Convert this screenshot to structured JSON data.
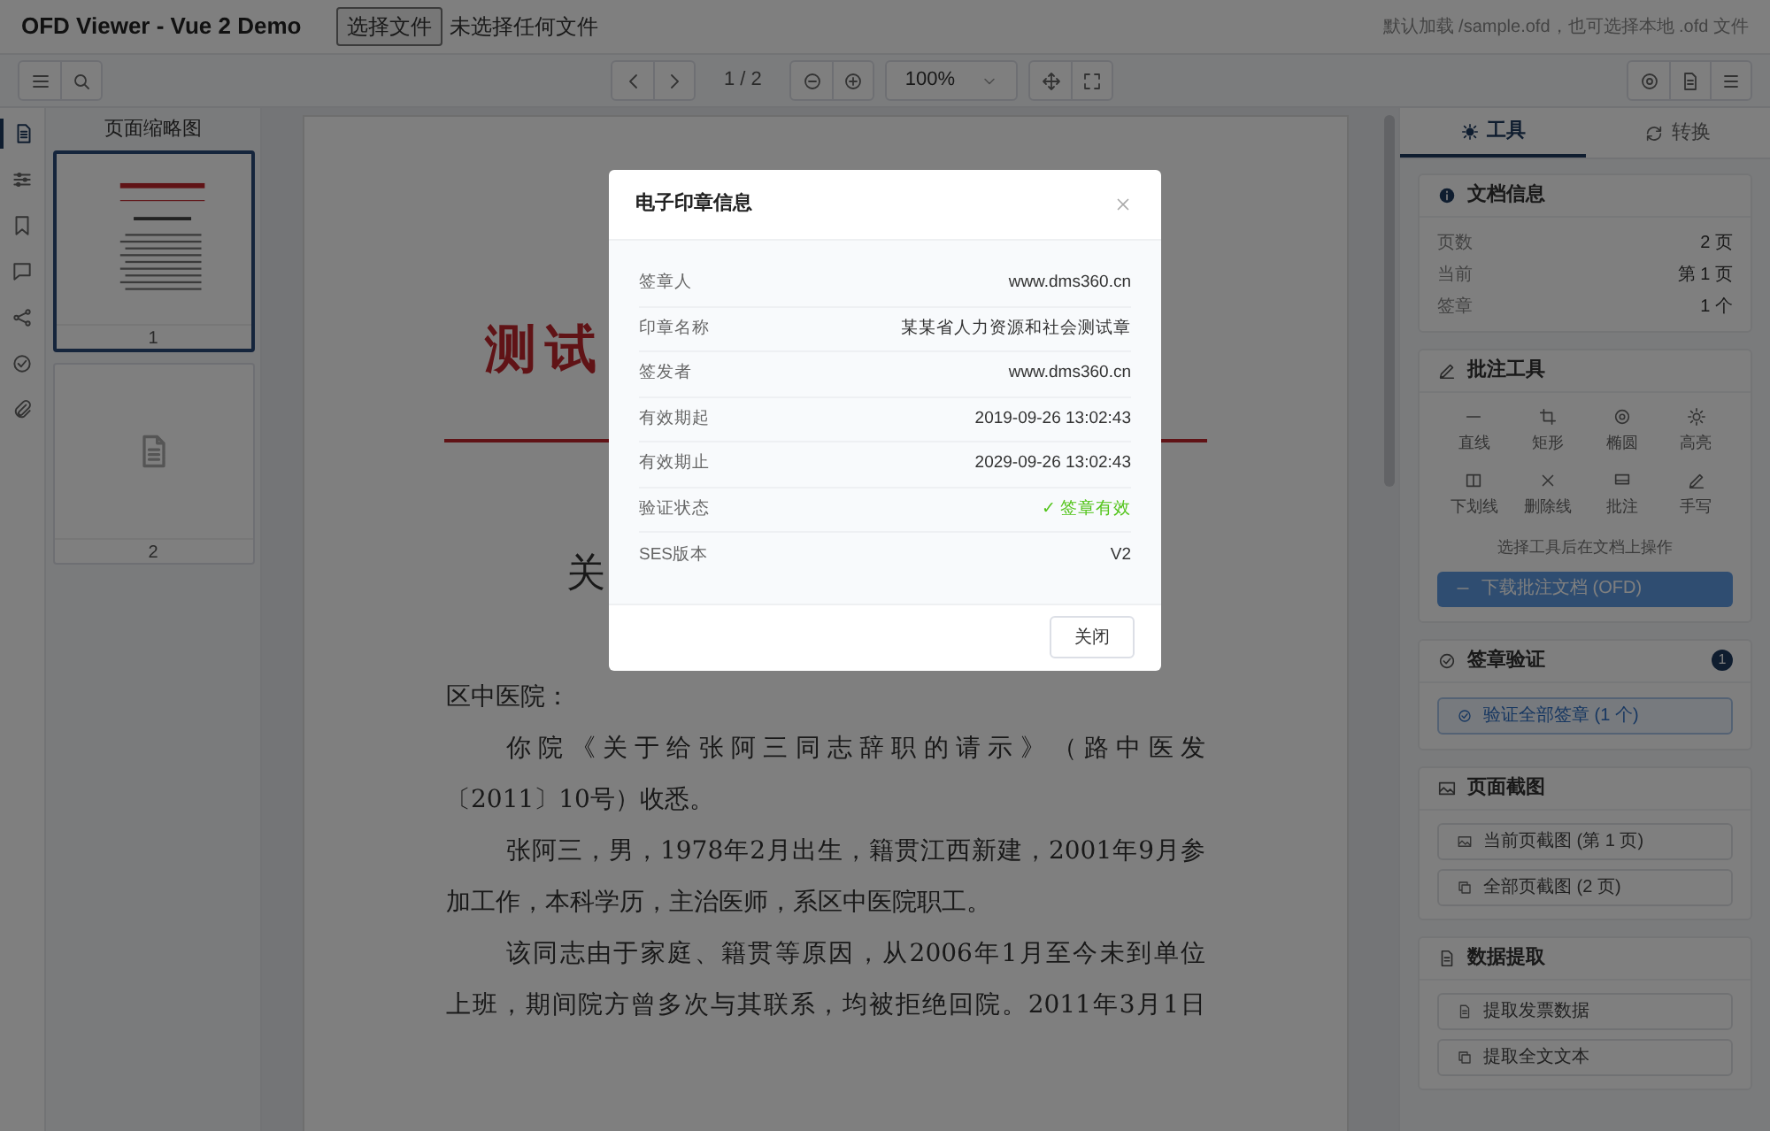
{
  "app": {
    "title": "OFD Viewer - Vue 2 Demo",
    "file_button": "选择文件",
    "file_status": "未选择任何文件",
    "hint": "默认加载 /sample.ofd，也可选择本地 .ofd 文件"
  },
  "toolbar": {
    "page_indicator": "1 / 2",
    "zoom": "100%"
  },
  "rail": [
    {
      "kind": "pages",
      "selected": true
    },
    {
      "kind": "outline",
      "selected": false
    },
    {
      "kind": "bookmark",
      "selected": false
    },
    {
      "kind": "annotations",
      "selected": false
    },
    {
      "kind": "share",
      "selected": false
    },
    {
      "kind": "seal",
      "selected": false
    },
    {
      "kind": "attachment",
      "selected": false
    }
  ],
  "thumbnails": {
    "title": "页面缩略图",
    "pages": [
      {
        "label": "1",
        "selected": true,
        "kind": "preview"
      },
      {
        "label": "2",
        "selected": false,
        "kind": "placeholder"
      }
    ]
  },
  "document": {
    "title": "测试",
    "heading": "关",
    "lines": [
      {
        "text": "区中医院：",
        "indent": false,
        "justify": false
      },
      {
        "text": "你院《关于给张阿三同志辞职的请示》（路中医发",
        "indent": true,
        "justify": true
      },
      {
        "text": "〔2011〕10号）收悉。",
        "indent": false,
        "justify": false
      },
      {
        "text": "张阿三，男，1978年2月出生，籍贯江西新建，2001年9月参",
        "indent": true,
        "justify": true
      },
      {
        "text": "加工作，本科学历，主治医师，系区中医院职工。",
        "indent": false,
        "justify": false
      },
      {
        "text": "该同志由于家庭、籍贯等原因，从2006年1月至今未到单位",
        "indent": true,
        "justify": true
      },
      {
        "text": "上班，期间院方曾多次与其联系，均被拒绝回院。2011年3月1日",
        "indent": false,
        "justify": true
      }
    ]
  },
  "panel": {
    "tabs": [
      {
        "label": "工具",
        "kind": "tools",
        "selected": true
      },
      {
        "label": "转换",
        "kind": "convert",
        "selected": false
      }
    ],
    "doc_info": {
      "title": "文档信息",
      "rows": [
        {
          "label": "页数",
          "value": "2 页"
        },
        {
          "label": "当前",
          "value": "第 1 页"
        },
        {
          "label": "签章",
          "value": "1 个"
        }
      ]
    },
    "annotation": {
      "title": "批注工具",
      "tools": [
        {
          "label": "直线",
          "kind": "line"
        },
        {
          "label": "矩形",
          "kind": "rect"
        },
        {
          "label": "椭圆",
          "kind": "ellipse"
        },
        {
          "label": "高亮",
          "kind": "highlight"
        },
        {
          "label": "下划线",
          "kind": "underline"
        },
        {
          "label": "删除线",
          "kind": "strike"
        },
        {
          "label": "批注",
          "kind": "note"
        },
        {
          "label": "手写",
          "kind": "pen"
        }
      ],
      "hint": "选择工具后在文档上操作",
      "download": "下载批注文档 (OFD)",
      "download_disabled": true
    },
    "signature": {
      "title": "签章验证",
      "badge": "1",
      "button": "验证全部签章 (1 个)"
    },
    "screenshot": {
      "title": "页面截图",
      "buttons": [
        {
          "label": "当前页截图 (第 1 页)",
          "kind": "image"
        },
        {
          "label": "全部页截图 (2 页)",
          "kind": "copy"
        }
      ]
    },
    "extract": {
      "title": "数据提取",
      "buttons": [
        {
          "label": "提取发票数据",
          "kind": "doc"
        },
        {
          "label": "提取全文文本",
          "kind": "copy"
        }
      ]
    }
  },
  "dialog": {
    "title": "电子印章信息",
    "rows": [
      {
        "label": "签章人",
        "value": "www.dms360.cn",
        "kind": "text"
      },
      {
        "label": "印章名称",
        "value": "某某省人力资源和社会测试章",
        "kind": "text"
      },
      {
        "label": "签发者",
        "value": "www.dms360.cn",
        "kind": "text"
      },
      {
        "label": "有效期起",
        "value": "2019-09-26 13:02:43",
        "kind": "text"
      },
      {
        "label": "有效期止",
        "value": "2029-09-26 13:02:43",
        "kind": "text"
      },
      {
        "label": "验证状态",
        "value": "✓ 签章有效",
        "kind": "status"
      },
      {
        "label": "SES版本",
        "value": "V2",
        "kind": "text"
      }
    ],
    "close": "关闭"
  }
}
